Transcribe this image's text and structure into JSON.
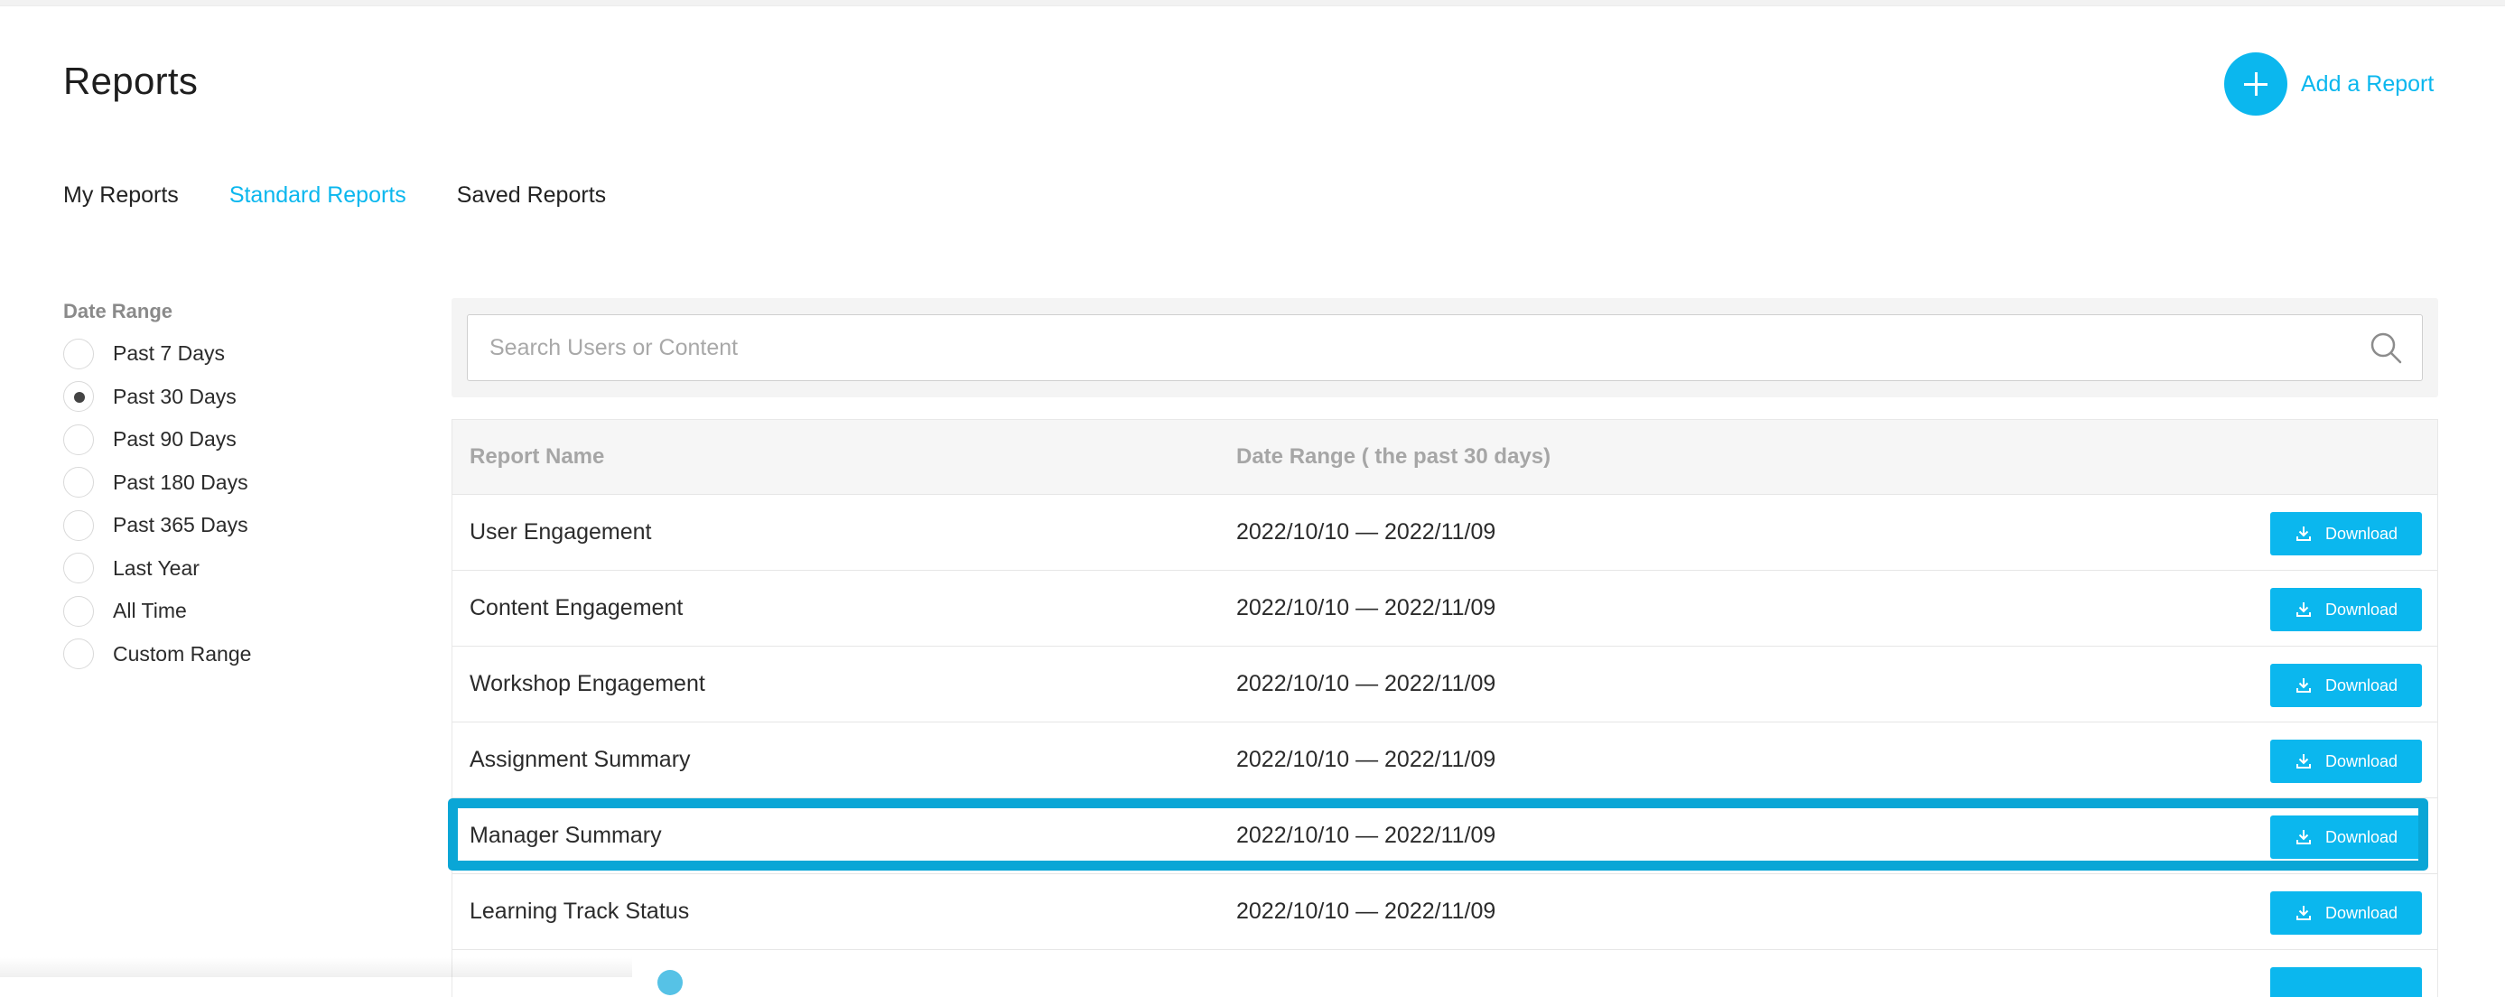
{
  "header": {
    "title": "Reports",
    "add_button_label": "Add a Report"
  },
  "tabs": [
    {
      "label": "My Reports",
      "active": false
    },
    {
      "label": "Standard Reports",
      "active": true
    },
    {
      "label": "Saved Reports",
      "active": false
    }
  ],
  "filters": {
    "title": "Date Range",
    "options": [
      {
        "label": "Past 7 Days",
        "checked": false
      },
      {
        "label": "Past 30 Days",
        "checked": true
      },
      {
        "label": "Past 90 Days",
        "checked": false
      },
      {
        "label": "Past 180 Days",
        "checked": false
      },
      {
        "label": "Past 365 Days",
        "checked": false
      },
      {
        "label": "Last Year",
        "checked": false
      },
      {
        "label": "All Time",
        "checked": false
      },
      {
        "label": "Custom Range",
        "checked": false
      }
    ]
  },
  "search": {
    "placeholder": "Search Users or Content",
    "icon": "search-icon"
  },
  "table": {
    "columns": [
      "Report Name",
      "Date Range ( the past 30 days)"
    ],
    "download_label": "Download",
    "rows": [
      {
        "name": "User Engagement",
        "date_range": "2022/10/10 — 2022/11/09"
      },
      {
        "name": "Content Engagement",
        "date_range": "2022/10/10 — 2022/11/09"
      },
      {
        "name": "Workshop Engagement",
        "date_range": "2022/10/10 — 2022/11/09"
      },
      {
        "name": "Assignment Summary",
        "date_range": "2022/10/10 — 2022/11/09"
      },
      {
        "name": "Manager Summary",
        "date_range": "2022/10/10 — 2022/11/09",
        "highlighted": true
      },
      {
        "name": "Learning Track Status",
        "date_range": "2022/10/10 — 2022/11/09"
      }
    ]
  },
  "colors": {
    "accent": "#0bb7ee",
    "highlight_border": "#0aa6d6"
  }
}
